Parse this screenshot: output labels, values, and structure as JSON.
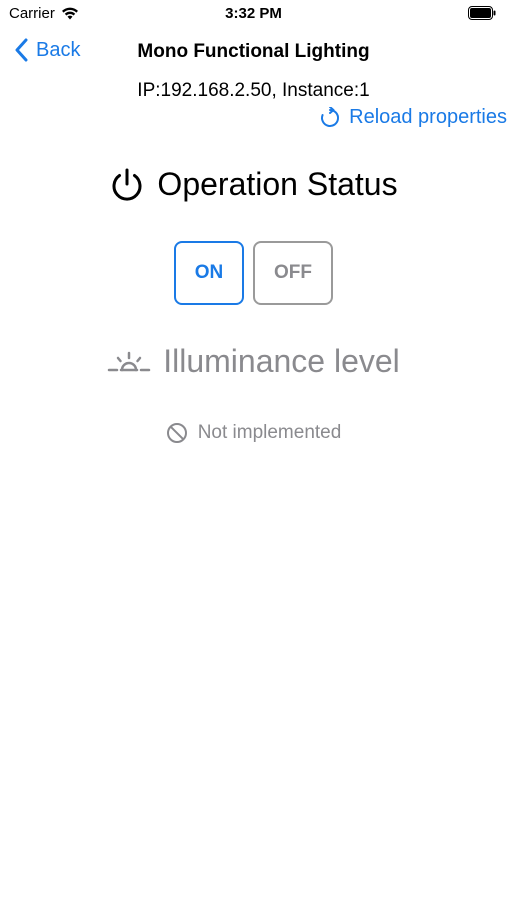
{
  "status_bar": {
    "carrier": "Carrier",
    "time": "3:32 PM"
  },
  "nav": {
    "back_label": "Back",
    "title": "Mono Functional Lighting"
  },
  "device": {
    "info": "IP:192.168.2.50, Instance:1",
    "reload_label": "Reload properties"
  },
  "operation_status": {
    "title": "Operation Status",
    "on_label": "ON",
    "off_label": "OFF",
    "selected": "ON"
  },
  "illuminance": {
    "title": "Illuminance level",
    "status": "Not implemented"
  },
  "colors": {
    "accent": "#1a7ae6",
    "disabled": "#8a8a8e"
  }
}
